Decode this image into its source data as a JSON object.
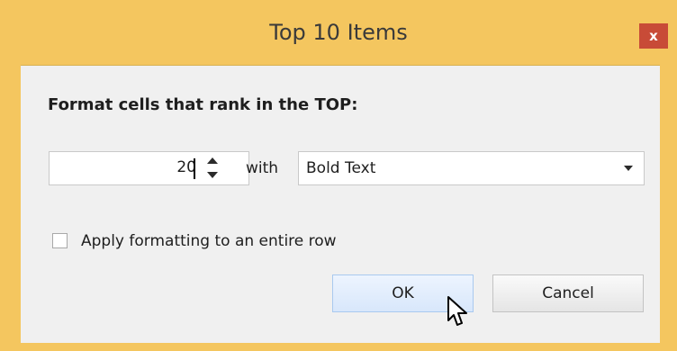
{
  "dialog": {
    "title": "Top 10 Items",
    "close_label": "x",
    "heading": "Format cells that rank in the TOP:",
    "rank_value": "20",
    "with_label": "with",
    "format_selected": "Bold Text",
    "apply_row": {
      "label": "Apply formatting to an entire row",
      "checked": false
    },
    "ok_label": "OK",
    "cancel_label": "Cancel"
  },
  "colors": {
    "frame": "#f4c65f",
    "close_button": "#c84b37",
    "client_background": "#f0f0f0",
    "ok_button": "#d8e7fb"
  },
  "icons": [
    "close-icon",
    "spin-up-icon",
    "spin-down-icon",
    "dropdown-arrow-icon",
    "mouse-cursor-icon"
  ]
}
